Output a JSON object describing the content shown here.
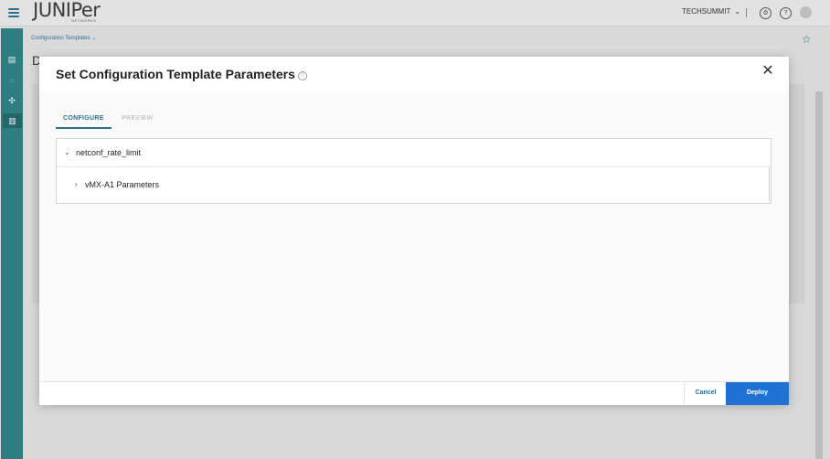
{
  "app": {
    "logo_text": "JUNIPer",
    "logo_subtext": "NETWORKS",
    "org_name": "TECHSUMMIT"
  },
  "icons": {
    "menu": "hamburger-icon",
    "settings": "gear-icon",
    "help": "question-icon",
    "star": "star-icon"
  },
  "background": {
    "breadcrumb": "Configuration Templates ⌄",
    "title_initial": "D"
  },
  "modal": {
    "title": "Set Configuration Template Parameters",
    "tabs": [
      {
        "label": "CONFIGURE",
        "active": true
      },
      {
        "label": "PREVIEW",
        "active": false
      }
    ],
    "accordion": {
      "title": "netconf_rate_limit",
      "expanded": true,
      "items": [
        {
          "label": "vMX-A1 Parameters",
          "expanded": false
        }
      ]
    },
    "footer": {
      "cancel_label": "Cancel",
      "deploy_label": "Deploy"
    }
  },
  "colors": {
    "accent": "#2d6f8f",
    "primary_button": "#1f72d4",
    "nav": "#2e7d80"
  }
}
